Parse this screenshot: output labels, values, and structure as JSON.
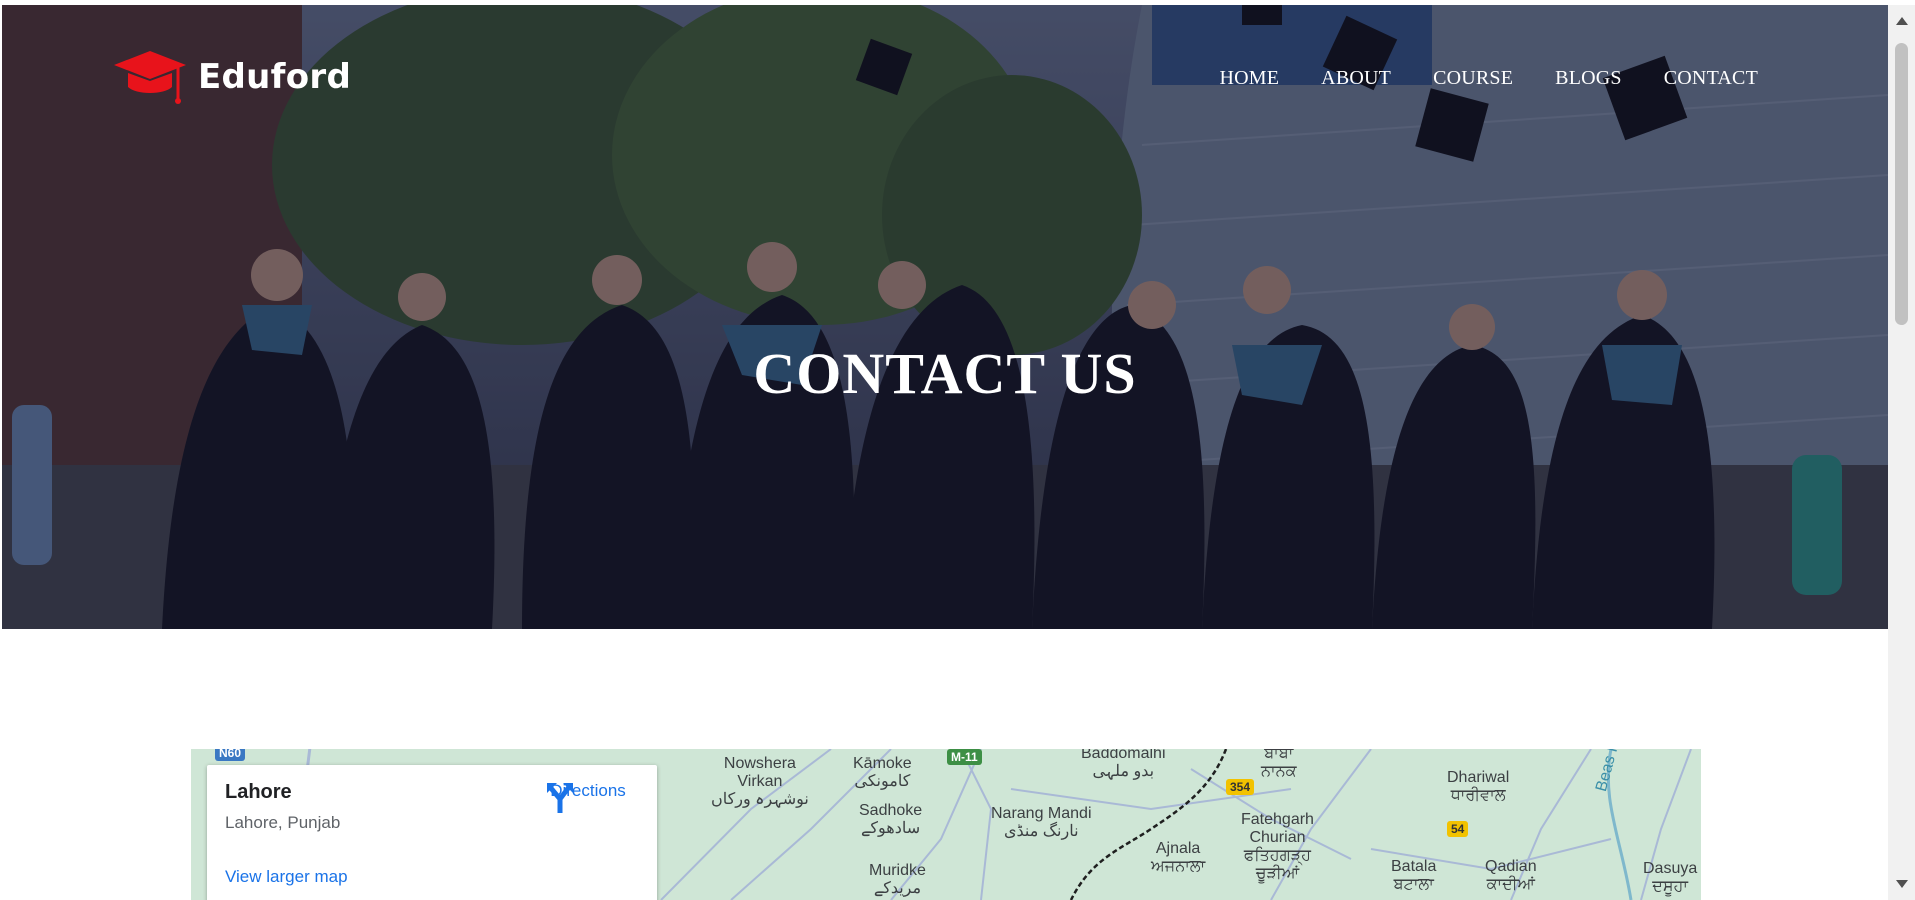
{
  "brand": {
    "name": "Eduford",
    "logo_icon": "graduation-cap-icon",
    "accent_color": "#e8131b"
  },
  "nav": {
    "items": [
      "HOME",
      "ABOUT",
      "COURSE",
      "BLOGS",
      "CONTACT"
    ]
  },
  "hero": {
    "title": "CONTACT US"
  },
  "map": {
    "place_title": "Lahore",
    "place_subtitle": "Lahore, Punjab",
    "directions_label": "Directions",
    "larger_map_label": "View larger map",
    "labels": {
      "nowshera": "Nowshera\nVirkan\nنوشہرہ ورکاں",
      "kamoke": "Kāmoke\nکامونکی",
      "sadhoke": "Sadhoke\nسادھوکے",
      "muridke": "Muridke\nمریدکے",
      "baddomalhi": "Baddomalhi\nبدو ملہی",
      "narang": "Narang Mandi\nنارنگ منڈی",
      "ajnala": "Ajnala\nਅਜਨਾਲਾ",
      "fatehgarh": "Fatehgarh\nChurian\nਫਤਿਹਗੜ੍ਹ\nਚੂੜੀਆਂ",
      "dhariwal": "Dhariwal\nਧਾਰੀਵਾਲ",
      "batala": "Batala\nਬਟਾਲਾ",
      "qadian": "Qadian\nਕਾਦੀਆਂ",
      "dasuya": "Dasuya\nਦਸੂਹਾ",
      "nanak": "ਬਾਬਾ\nਨਾਨਕ",
      "beas": "Beas Ri"
    },
    "badges": {
      "n60": "N60",
      "m11": "M-11",
      "r354": "354",
      "r54": "54"
    }
  }
}
